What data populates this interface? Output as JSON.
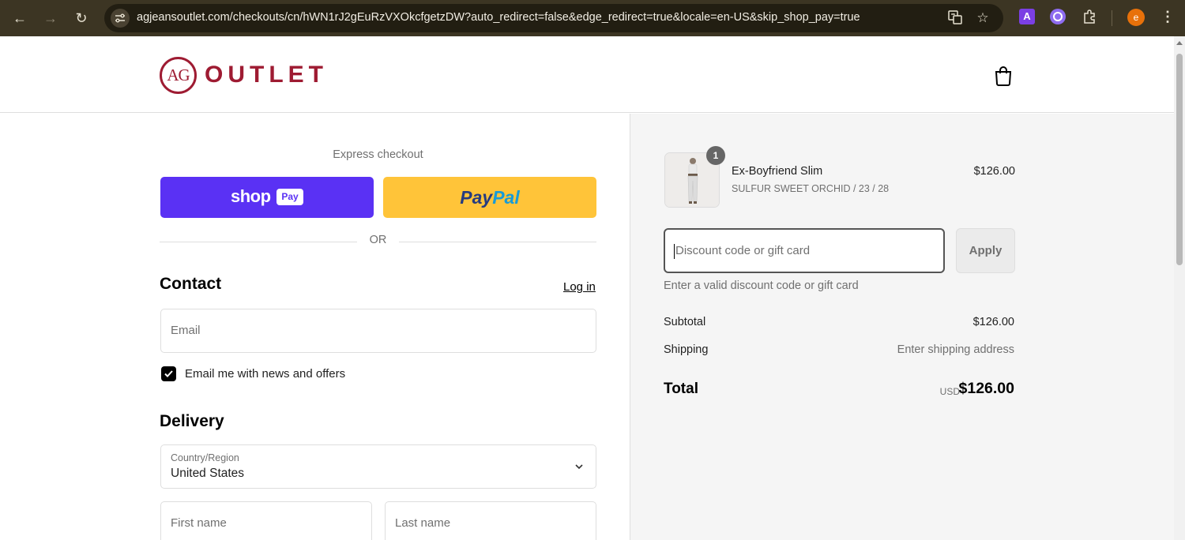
{
  "browser": {
    "url": "agjeansoutlet.com/checkouts/cn/hWN1rJ2gEuRzVXOkcfgetzDW?auto_redirect=false&edge_redirect=true&locale=en-US&skip_shop_pay=true",
    "back_icon": "←",
    "forward_icon": "→",
    "reload_icon": "↻",
    "ext_a_label": "A",
    "avatar_letter": "e"
  },
  "header": {
    "logo_monogram": "AG",
    "logo_word": "OUTLET"
  },
  "express": {
    "title": "Express checkout",
    "shop_word": "shop",
    "shop_pay_badge": "Pay",
    "paypal_part1": "Pay",
    "paypal_part2": "Pal",
    "or_text": "OR"
  },
  "contact": {
    "heading": "Contact",
    "login_link": "Log in",
    "email_placeholder": "Email",
    "newsletter_label": "Email me with news and offers",
    "newsletter_checked": true
  },
  "delivery": {
    "heading": "Delivery",
    "country_label": "Country/Region",
    "country_value": "United States",
    "first_name_placeholder": "First name",
    "last_name_placeholder": "Last name"
  },
  "order": {
    "quantity": "1",
    "product_name": "Ex-Boyfriend Slim",
    "product_variant": "SULFUR SWEET ORCHID / 23 / 28",
    "product_price": "$126.00",
    "discount_placeholder": "Discount code or gift card",
    "apply_label": "Apply",
    "discount_error": "Enter a valid discount code or gift card",
    "subtotal_label": "Subtotal",
    "subtotal_value": "$126.00",
    "shipping_label": "Shipping",
    "shipping_value": "Enter shipping address",
    "total_label": "Total",
    "total_currency": "USD",
    "total_value": "$126.00"
  },
  "colors": {
    "brand": "#9e1b32",
    "shop_pay": "#5a31f4",
    "paypal": "#ffc439"
  }
}
